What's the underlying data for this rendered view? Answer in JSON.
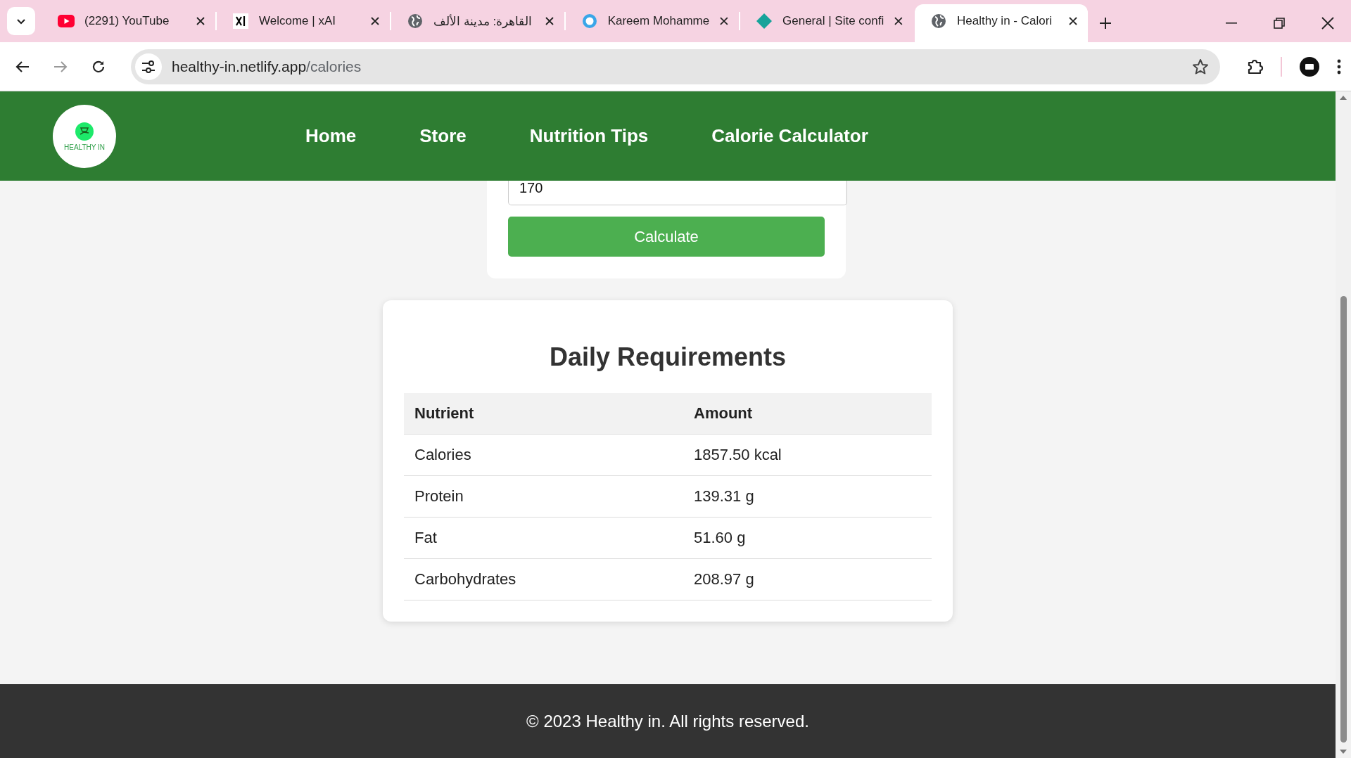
{
  "browser": {
    "tabs": [
      {
        "title": "(2291) YouTube",
        "selected": false
      },
      {
        "title": "Welcome | xAI",
        "selected": false
      },
      {
        "title": "القاهرة: مدينة الألف",
        "selected": false
      },
      {
        "title": "Kareem Mohamme",
        "selected": false
      },
      {
        "title": "General | Site confi",
        "selected": false
      },
      {
        "title": "Healthy in - Calori",
        "selected": true
      }
    ],
    "address": {
      "host": "healthy-in.netlify.app",
      "path": "/calories"
    }
  },
  "header": {
    "logo": "HEALTHY IN",
    "nav": [
      {
        "label": "Home"
      },
      {
        "label": "Store"
      },
      {
        "label": "Nutrition Tips"
      },
      {
        "label": "Calorie Calculator"
      }
    ]
  },
  "calculator": {
    "value": "170",
    "button": "Calculate"
  },
  "requirements": {
    "title": "Daily Requirements",
    "columns": [
      "Nutrient",
      "Amount"
    ],
    "rows": [
      [
        "Calories",
        "1857.50 kcal"
      ],
      [
        "Protein",
        "139.31 g"
      ],
      [
        "Fat",
        "51.60 g"
      ],
      [
        "Carbohydrates",
        "208.97 g"
      ]
    ]
  },
  "footer": {
    "text": "© 2023 Healthy in. All rights reserved."
  }
}
